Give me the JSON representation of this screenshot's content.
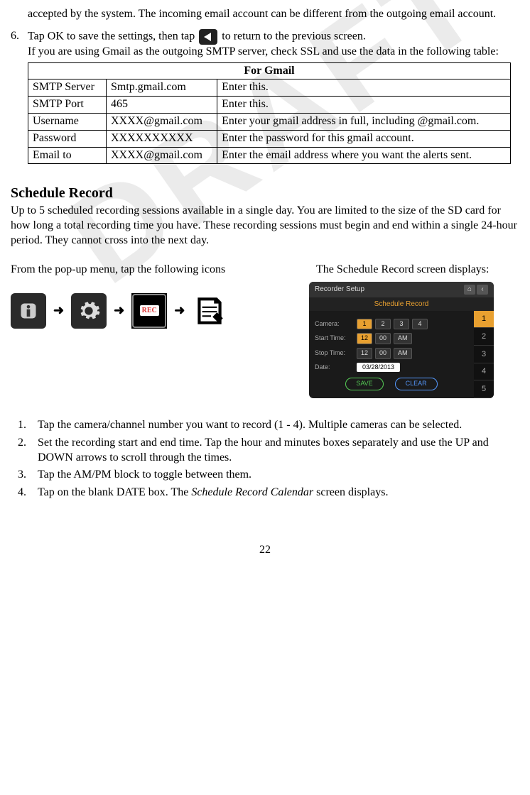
{
  "intro_fragment": "accepted by the system. The incoming email account can be different from the outgoing email account.",
  "step6": {
    "num": "6.",
    "line1a": "Tap OK to save the settings, then tap ",
    "line1b": " to return to the previous screen.",
    "line2": "If you are using Gmail as the outgoing SMTP server, check SSL and use the data in the following table:"
  },
  "table": {
    "header": "For Gmail",
    "rows": [
      {
        "c1": "SMTP Server",
        "c2": "Smtp.gmail.com",
        "c3": "Enter this."
      },
      {
        "c1": "SMTP Port",
        "c2": "465",
        "c3": "Enter this."
      },
      {
        "c1": "Username",
        "c2": "XXXX@gmail.com",
        "c3": "Enter your gmail address in full, including @gmail.com."
      },
      {
        "c1": "Password",
        "c2": "XXXXXXXXXX",
        "c3": "Enter the password for this gmail account."
      },
      {
        "c1": "Email to",
        "c2": "XXXX@gmail.com",
        "c3": "Enter the email address where you want the alerts sent."
      }
    ]
  },
  "section_title": "Schedule Record",
  "section_body": "Up to 5 scheduled recording sessions available in a single day. You are limited to the size of the SD card for how long a total recording time you have. These recording sessions must begin and end within a single 24-hour period. They cannot cross into the next day.",
  "left_caption": "From the pop-up menu, tap the following icons",
  "right_caption": "The Schedule Record screen displays:",
  "arrow": "➜",
  "ui": {
    "title": "Recorder Setup",
    "subtitle": "Schedule Record",
    "camera_label": "Camera:",
    "camera_opts": [
      "1",
      "2",
      "3",
      "4"
    ],
    "start_label": "Start Time:",
    "stop_label": "Stop Time:",
    "hh": "12",
    "mm": "00",
    "ampm": "AM",
    "date_label": "Date:",
    "date_value": "03/28/2013",
    "save": "SAVE",
    "clear": "CLEAR",
    "side": [
      "1",
      "2",
      "3",
      "4",
      "5"
    ]
  },
  "steps": [
    {
      "n": "1.",
      "t": "Tap the camera/channel number you want to record (1 - 4). Multiple cameras can be selected."
    },
    {
      "n": "2.",
      "t": "Set the recording start and end time. Tap the hour and minutes boxes separately and use the UP and DOWN arrows to scroll through the times."
    },
    {
      "n": "3.",
      "t": "Tap the AM/PM block to toggle between them."
    },
    {
      "n": "4.",
      "t_pre": "Tap on the blank DATE box. The ",
      "t_italic": "Schedule Record Calendar",
      "t_post": " screen displays."
    }
  ],
  "page_number": "22"
}
